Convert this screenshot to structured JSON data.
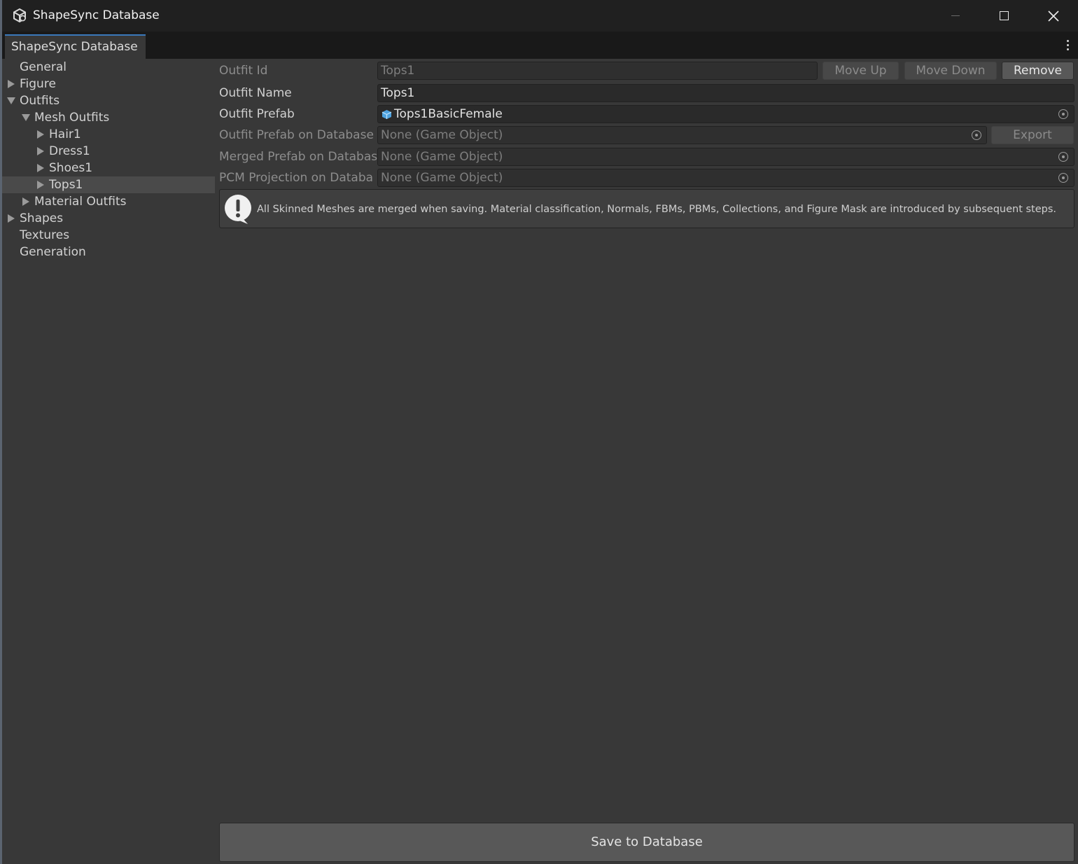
{
  "window": {
    "title": "ShapeSync Database",
    "tab_label": "ShapeSync Database",
    "accent_color": "#3a79bb"
  },
  "tree": {
    "items": [
      {
        "label": "General",
        "level": 0,
        "expander": "none",
        "selected": false
      },
      {
        "label": "Figure",
        "level": 0,
        "expander": "collapsed",
        "selected": false
      },
      {
        "label": "Outfits",
        "level": 0,
        "expander": "expanded",
        "selected": false
      },
      {
        "label": "Mesh Outfits",
        "level": 1,
        "expander": "expanded",
        "selected": false
      },
      {
        "label": "Hair1",
        "level": 2,
        "expander": "collapsed",
        "selected": false
      },
      {
        "label": "Dress1",
        "level": 2,
        "expander": "collapsed",
        "selected": false
      },
      {
        "label": "Shoes1",
        "level": 2,
        "expander": "collapsed",
        "selected": false
      },
      {
        "label": "Tops1",
        "level": 2,
        "expander": "collapsed",
        "selected": true
      },
      {
        "label": "Material Outfits",
        "level": 1,
        "expander": "collapsed",
        "selected": false
      },
      {
        "label": "Shapes",
        "level": 0,
        "expander": "collapsed",
        "selected": false
      },
      {
        "label": "Textures",
        "level": 0,
        "expander": "none",
        "selected": false
      },
      {
        "label": "Generation",
        "level": 0,
        "expander": "none",
        "selected": false
      }
    ]
  },
  "inspector": {
    "outfit_id": {
      "label": "Outfit Id",
      "value": "Tops1"
    },
    "move_up_label": "Move Up",
    "move_down_label": "Move Down",
    "remove_label": "Remove",
    "outfit_name": {
      "label": "Outfit Name",
      "value": "Tops1"
    },
    "outfit_prefab": {
      "label": "Outfit Prefab",
      "value": "Tops1BasicFemale",
      "icon": "prefab-icon"
    },
    "outfit_prefab_db": {
      "label": "Outfit Prefab on Database",
      "value": "None (Game Object)"
    },
    "export_label": "Export",
    "merged_prefab_db": {
      "label": "Merged Prefab on Databas",
      "value": "None (Game Object)"
    },
    "pcm_projection_db": {
      "label": "PCM Projection on Databa",
      "value": "None (Game Object)"
    },
    "help_text": "All Skinned Meshes are merged when saving. Material classification, Normals, FBMs, PBMs, Collections, and Figure Mask are introduced by subsequent steps.",
    "save_label": "Save to Database"
  }
}
